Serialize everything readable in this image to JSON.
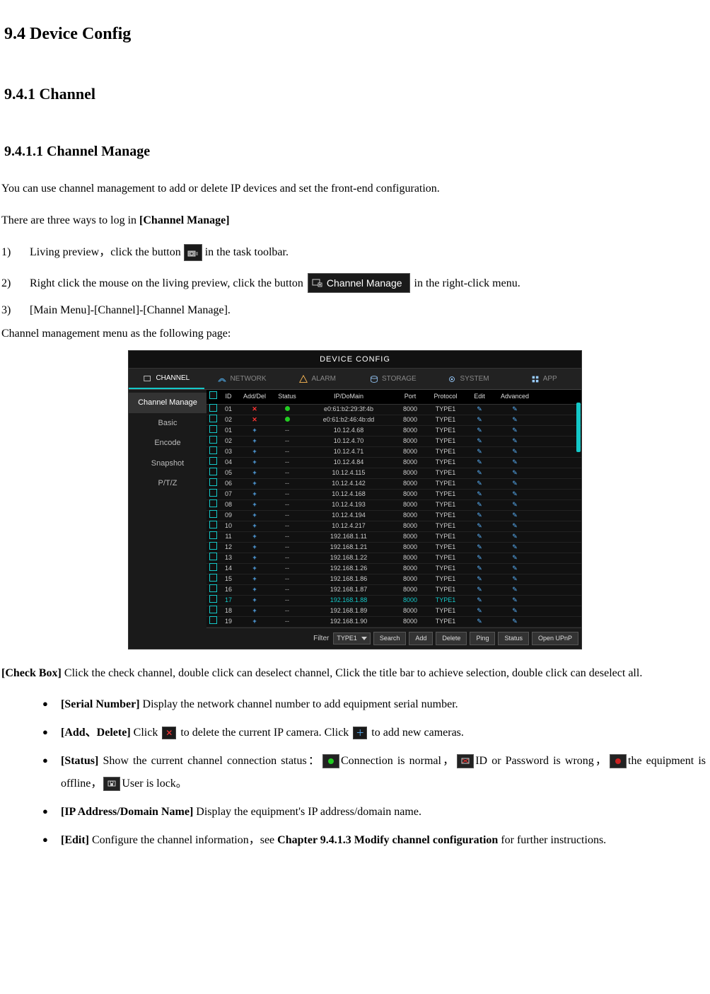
{
  "headings": {
    "h1": "9.4 Device Config",
    "h2": "9.4.1  Channel",
    "h3": "9.4.1.1 Channel Manage"
  },
  "intro": {
    "p1": "You can use channel management to add or delete IP devices and set the front-end configuration.",
    "p2a": "There are three ways to log in ",
    "p2b": "[Channel Manage]"
  },
  "steps": {
    "s1_num": "1)",
    "s1a": "Living preview，click the button ",
    "s1b": " in the task toolbar.",
    "s2_num": "2)",
    "s2a": "Right click the mouse on the living preview, click the button ",
    "s2b": " in the right-click menu.",
    "s2_btn": "Channel Manage",
    "s3_num": "3)",
    "s3": "[Main Menu]-[Channel]-[Channel Manage]."
  },
  "fig_caption": "Channel management menu as the following page:",
  "device_config": {
    "title": "DEVICE CONFIG",
    "toptabs": [
      "CHANNEL",
      "NETWORK",
      "ALARM",
      "STORAGE",
      "SYSTEM",
      "APP"
    ],
    "sidebar": [
      "Channel Manage",
      "Basic",
      "Encode",
      "Snapshot",
      "P/T/Z"
    ],
    "columns": [
      "",
      "ID",
      "Add/Del",
      "Status",
      "IP/DoMain",
      "Port",
      "Protocol",
      "Edit",
      "Advanced"
    ],
    "rows": [
      {
        "id": "01",
        "ad": "x",
        "st": "g",
        "ip": "e0:61:b2:29:3f:4b",
        "port": "8000",
        "proto": "TYPE1"
      },
      {
        "id": "02",
        "ad": "x",
        "st": "g",
        "ip": "e0:61:b2:46:4b:dd",
        "port": "8000",
        "proto": "TYPE1"
      },
      {
        "id": "01",
        "ad": "+",
        "st": "-",
        "ip": "10.12.4.68",
        "port": "8000",
        "proto": "TYPE1"
      },
      {
        "id": "02",
        "ad": "+",
        "st": "-",
        "ip": "10.12.4.70",
        "port": "8000",
        "proto": "TYPE1"
      },
      {
        "id": "03",
        "ad": "+",
        "st": "-",
        "ip": "10.12.4.71",
        "port": "8000",
        "proto": "TYPE1"
      },
      {
        "id": "04",
        "ad": "+",
        "st": "-",
        "ip": "10.12.4.84",
        "port": "8000",
        "proto": "TYPE1"
      },
      {
        "id": "05",
        "ad": "+",
        "st": "-",
        "ip": "10.12.4.115",
        "port": "8000",
        "proto": "TYPE1"
      },
      {
        "id": "06",
        "ad": "+",
        "st": "-",
        "ip": "10.12.4.142",
        "port": "8000",
        "proto": "TYPE1"
      },
      {
        "id": "07",
        "ad": "+",
        "st": "-",
        "ip": "10.12.4.168",
        "port": "8000",
        "proto": "TYPE1"
      },
      {
        "id": "08",
        "ad": "+",
        "st": "-",
        "ip": "10.12.4.193",
        "port": "8000",
        "proto": "TYPE1"
      },
      {
        "id": "09",
        "ad": "+",
        "st": "-",
        "ip": "10.12.4.194",
        "port": "8000",
        "proto": "TYPE1"
      },
      {
        "id": "10",
        "ad": "+",
        "st": "-",
        "ip": "10.12.4.217",
        "port": "8000",
        "proto": "TYPE1"
      },
      {
        "id": "11",
        "ad": "+",
        "st": "-",
        "ip": "192.168.1.11",
        "port": "8000",
        "proto": "TYPE1"
      },
      {
        "id": "12",
        "ad": "+",
        "st": "-",
        "ip": "192.168.1.21",
        "port": "8000",
        "proto": "TYPE1"
      },
      {
        "id": "13",
        "ad": "+",
        "st": "-",
        "ip": "192.168.1.22",
        "port": "8000",
        "proto": "TYPE1"
      },
      {
        "id": "14",
        "ad": "+",
        "st": "-",
        "ip": "192.168.1.26",
        "port": "8000",
        "proto": "TYPE1"
      },
      {
        "id": "15",
        "ad": "+",
        "st": "-",
        "ip": "192.168.1.86",
        "port": "8000",
        "proto": "TYPE1"
      },
      {
        "id": "16",
        "ad": "+",
        "st": "-",
        "ip": "192.168.1.87",
        "port": "8000",
        "proto": "TYPE1"
      },
      {
        "id": "17",
        "ad": "+",
        "st": "-",
        "ip": "192.168.1.88",
        "port": "8000",
        "proto": "TYPE1",
        "hl": true
      },
      {
        "id": "18",
        "ad": "+",
        "st": "-",
        "ip": "192.168.1.89",
        "port": "8000",
        "proto": "TYPE1"
      },
      {
        "id": "19",
        "ad": "+",
        "st": "-",
        "ip": "192.168.1.90",
        "port": "8000",
        "proto": "TYPE1"
      }
    ],
    "filter_label": "Filter",
    "filter_value": "TYPE1",
    "buttons": [
      "Search",
      "Add",
      "Delete",
      "Ping",
      "Status",
      "Open UPnP"
    ]
  },
  "after": {
    "checkbox_a": "[Check Box] ",
    "checkbox_b": "Click the check channel, double click can deselect channel, Click the title bar to achieve selection, double click can deselect all.",
    "b1_a": "[Serial Number] ",
    "b1_b": "Display the network channel number to add equipment serial number.",
    "b2_a": "Add、Delete] ",
    "b2_b": "Click ",
    "b2_c": " to delete the current IP camera. Click ",
    "b2_d": " to add new cameras.",
    "b3_a": "[Status] ",
    "b3_b": "Show the current channel connection status：",
    "b3_c": "Connection is normal，",
    "b3_d": "ID or Password is wrong，",
    "b3_e": "the equipment is offline，",
    "b3_f": "User is lock。",
    "b4_a": "[IP Address/Domain Name] ",
    "b4_b": "Display the equipment's IP address/domain name.",
    "b5_a": "[Edit] ",
    "b5_b": "Configure the channel information，see ",
    "b5_c": "Chapter 9.4.1.3 Modify channel configuration ",
    "b5_d": "for further instructions."
  }
}
